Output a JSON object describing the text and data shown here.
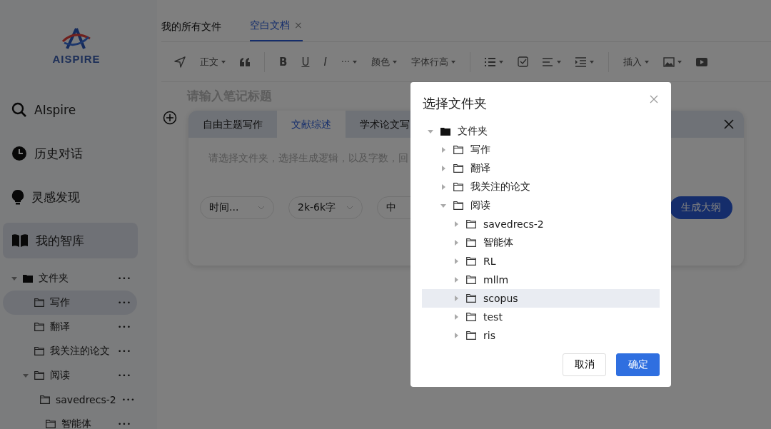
{
  "sidebar": {
    "logo_text": "AISPIRE",
    "nav": [
      {
        "label": "AIspire",
        "kind": "search",
        "selected": false
      },
      {
        "label": "历史对话",
        "kind": "clock",
        "selected": false
      },
      {
        "label": "灵感发现",
        "kind": "bulb",
        "selected": false
      },
      {
        "label": "我的智库",
        "kind": "book",
        "selected": true
      }
    ],
    "more_glyph": "•••",
    "tree": {
      "label": "文件夹",
      "expanded": true,
      "children": [
        {
          "label": "写作",
          "selected": true
        },
        {
          "label": "翻译",
          "selected": false
        },
        {
          "label": "我关注的论文",
          "selected": false
        },
        {
          "label": "阅读",
          "selected": false,
          "expanded": true,
          "children": [
            {
              "label": "savedrecs-2",
              "selected": false
            },
            {
              "label": "智能体",
              "selected": false
            }
          ]
        }
      ]
    }
  },
  "tabs": [
    {
      "label": "我的所有文件",
      "selected": false
    },
    {
      "label": "空白文档",
      "selected": true,
      "close_glyph": "×"
    }
  ],
  "toolbar": [
    {
      "kind": "send"
    },
    {
      "kind": "text",
      "label": "正文",
      "dropdown": true
    },
    {
      "kind": "quote"
    },
    {
      "kind": "sep"
    },
    {
      "kind": "bold",
      "label": "B"
    },
    {
      "kind": "underline",
      "label": "U"
    },
    {
      "kind": "italic",
      "label": "I"
    },
    {
      "kind": "text",
      "label": "···",
      "dropdown": true
    },
    {
      "kind": "text",
      "label": "颜色",
      "dropdown": true
    },
    {
      "kind": "text",
      "label": "字体行高",
      "dropdown": true
    },
    {
      "kind": "sep"
    },
    {
      "kind": "list"
    },
    {
      "kind": "check"
    },
    {
      "kind": "align"
    },
    {
      "kind": "indent"
    },
    {
      "kind": "sep"
    },
    {
      "kind": "text",
      "label": "插入",
      "dropdown": true
    },
    {
      "kind": "image"
    },
    {
      "kind": "video"
    }
  ],
  "editor": {
    "title_placeholder": "请输入笔记标题"
  },
  "writer": {
    "tabs": [
      {
        "label": "自由主题写作",
        "selected": false
      },
      {
        "label": "文献综述",
        "selected": true
      },
      {
        "label": "学术论文写",
        "selected": false
      }
    ],
    "prompt_placeholder": "请选择文件夹，选择生成逻辑，以及字数，回",
    "selects": [
      {
        "value": "时间...",
        "chevron": true
      },
      {
        "value": "2k-6k字",
        "chevron": true
      },
      {
        "value": "中",
        "chevron": false
      }
    ],
    "generate_button": "生成大纲"
  },
  "dialog": {
    "title": "选择文件夹",
    "tree": {
      "label": "文件夹",
      "expanded": true,
      "selected": false,
      "children": [
        {
          "label": "写作",
          "expanded": false,
          "selected": false
        },
        {
          "label": "翻译",
          "expanded": false,
          "selected": false
        },
        {
          "label": "我关注的论文",
          "expanded": false,
          "selected": false
        },
        {
          "label": "阅读",
          "expanded": true,
          "selected": false,
          "children": [
            {
              "label": "savedrecs-2",
              "expanded": false,
              "selected": false
            },
            {
              "label": "智能体",
              "expanded": false,
              "selected": false
            },
            {
              "label": "RL",
              "expanded": false,
              "selected": false
            },
            {
              "label": "mllm",
              "expanded": false,
              "selected": false
            },
            {
              "label": "scopus",
              "expanded": false,
              "selected": true
            },
            {
              "label": "test",
              "expanded": false,
              "selected": false
            },
            {
              "label": "ris",
              "expanded": false,
              "selected": false
            }
          ]
        }
      ]
    },
    "buttons": [
      {
        "label": "取消",
        "kind": "secondary"
      },
      {
        "label": "确定",
        "kind": "primary"
      }
    ]
  }
}
